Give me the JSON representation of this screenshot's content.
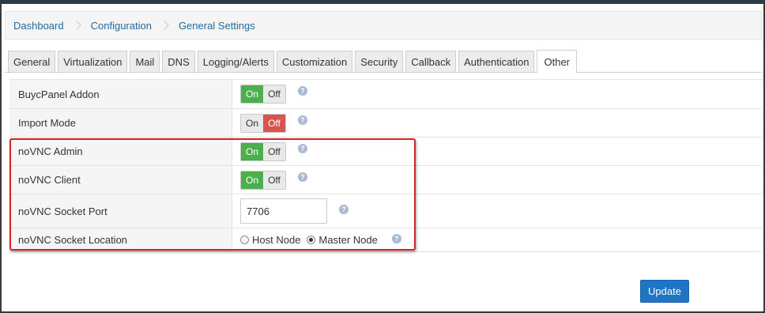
{
  "breadcrumb": {
    "items": [
      "Dashboard",
      "Configuration",
      "General Settings"
    ]
  },
  "tabs": [
    {
      "label": "General"
    },
    {
      "label": "Virtualization"
    },
    {
      "label": "Mail"
    },
    {
      "label": "DNS"
    },
    {
      "label": "Logging/Alerts"
    },
    {
      "label": "Customization"
    },
    {
      "label": "Security"
    },
    {
      "label": "Callback"
    },
    {
      "label": "Authentication"
    },
    {
      "label": "Other",
      "active": true
    }
  ],
  "settings": {
    "buycpanel": {
      "label": "BuycPanel Addon",
      "on": "On",
      "off": "Off",
      "state": "on"
    },
    "import_mode": {
      "label": "Import Mode",
      "on": "On",
      "off": "Off",
      "state": "off"
    },
    "novnc_admin": {
      "label": "noVNC Admin",
      "on": "On",
      "off": "Off",
      "state": "on"
    },
    "novnc_client": {
      "label": "noVNC Client",
      "on": "On",
      "off": "Off",
      "state": "on"
    },
    "novnc_port": {
      "label": "noVNC Socket Port",
      "value": "7706"
    },
    "novnc_location": {
      "label": "noVNC Socket Location",
      "options": [
        "Host Node",
        "Master Node"
      ],
      "selected": "Master Node"
    }
  },
  "help_glyph": "?",
  "actions": {
    "update_label": "Update"
  },
  "colors": {
    "on_active": "#4cae4c",
    "off_active": "#d9534f",
    "link": "#1f6aa5",
    "primary_button": "#1f74c4",
    "highlight_border": "#d0262a"
  }
}
